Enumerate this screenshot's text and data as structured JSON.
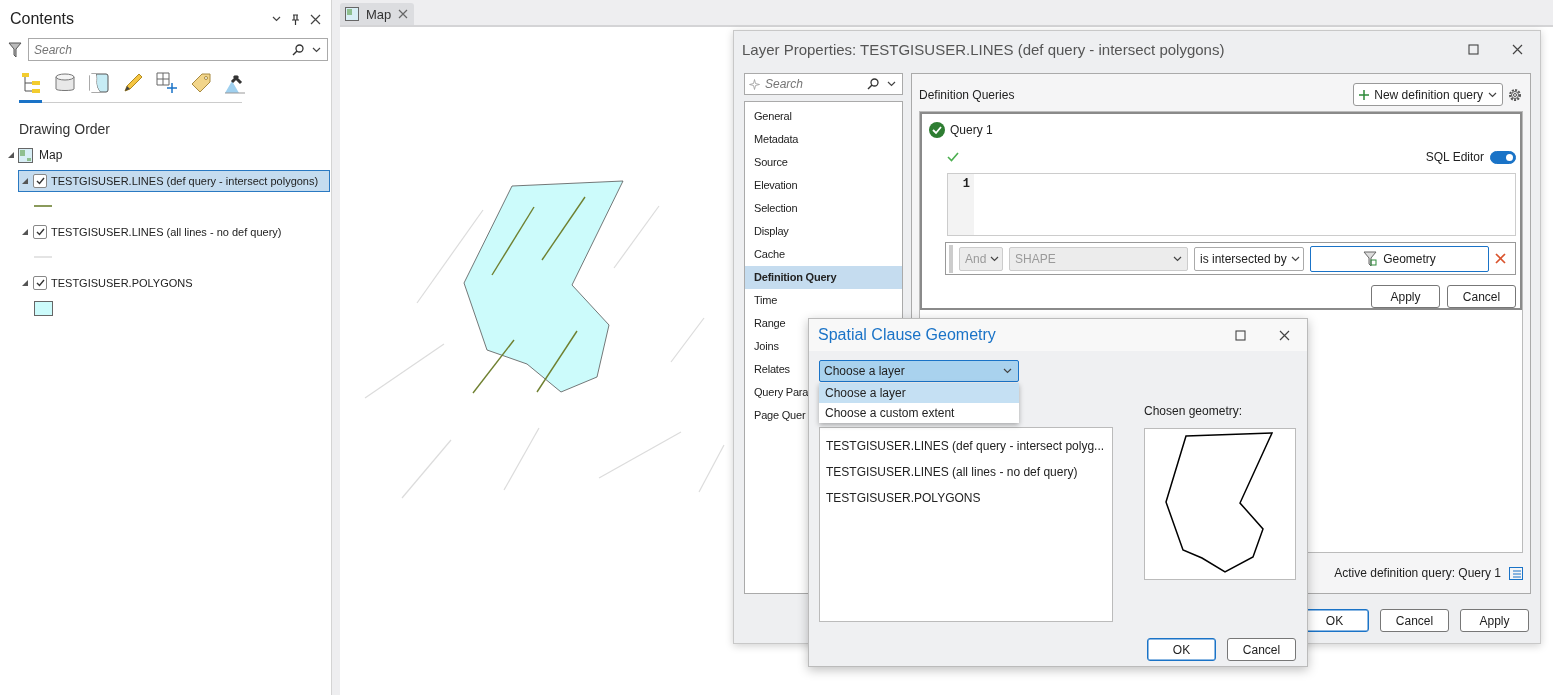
{
  "contents": {
    "title": "Contents",
    "search": {
      "placeholder": "Search"
    },
    "view_tabs": [
      {
        "kind": "tree",
        "selected": true
      },
      {
        "kind": "database",
        "selected": false
      },
      {
        "kind": "map",
        "selected": false
      },
      {
        "kind": "pencil",
        "selected": false
      },
      {
        "kind": "grid",
        "selected": false
      },
      {
        "kind": "tag",
        "selected": false
      },
      {
        "kind": "satellite",
        "selected": false
      }
    ],
    "heading": "Drawing Order",
    "tree": [
      {
        "label": "Map",
        "kind": "map",
        "expanded": true,
        "children": [
          {
            "label": "TESTGISUSER.LINES (def query - intersect polygons)",
            "expanded": true,
            "checked": true,
            "selected": true,
            "symbol": {
              "kind": "line",
              "color": "#8a9a5b"
            }
          },
          {
            "label": "TESTGISUSER.LINES (all lines - no def query)",
            "expanded": true,
            "checked": true,
            "selected": false,
            "symbol": {
              "kind": "line",
              "color": "#e4e4e4"
            }
          },
          {
            "label": "TESTGISUSER.POLYGONS",
            "expanded": true,
            "checked": true,
            "selected": false,
            "symbol": {
              "kind": "fill",
              "color": "#ccfbfb"
            }
          }
        ]
      }
    ]
  },
  "map_tab": {
    "label": "Map",
    "selected": true
  },
  "layer_properties": {
    "title": "Layer Properties: TESTGISUSER.LINES (def query - intersect polygons)",
    "search": {
      "placeholder": "Search"
    },
    "pages": [
      {
        "label": "General",
        "selected": false
      },
      {
        "label": "Metadata",
        "selected": false
      },
      {
        "label": "Source",
        "selected": false
      },
      {
        "label": "Elevation",
        "selected": false
      },
      {
        "label": "Selection",
        "selected": false
      },
      {
        "label": "Display",
        "selected": false
      },
      {
        "label": "Cache",
        "selected": false
      },
      {
        "label": "Definition Query",
        "selected": true
      },
      {
        "label": "Time",
        "selected": false
      },
      {
        "label": "Range",
        "selected": false
      },
      {
        "label": "Joins",
        "selected": false
      },
      {
        "label": "Relates",
        "selected": false
      },
      {
        "label": "Query Para",
        "selected": false
      },
      {
        "label": "Page Quer",
        "selected": false
      }
    ],
    "heading": "Definition Queries",
    "new_button": "New definition query",
    "query": {
      "name": "Query 1",
      "valid": true,
      "sql_editor": {
        "label": "SQL Editor",
        "on": true
      },
      "line_numbers": [
        "1"
      ],
      "clause": {
        "connector": {
          "value": "And",
          "disabled": true
        },
        "field": {
          "value": "SHAPE",
          "disabled": true
        },
        "operator": {
          "value": "is intersected by",
          "disabled": false
        },
        "geometry_button": "Geometry"
      },
      "buttons": [
        {
          "label": "Apply",
          "default": false
        },
        {
          "label": "Cancel",
          "default": false
        }
      ]
    },
    "active_query": "Active definition query: Query 1",
    "buttons": [
      {
        "label": "OK",
        "default": true
      },
      {
        "label": "Cancel",
        "default": false
      },
      {
        "label": "Apply",
        "default": false
      }
    ]
  },
  "spatial_dialog": {
    "title": "Spatial Clause Geometry",
    "dropdown": {
      "value": "Choose a layer",
      "expanded": true,
      "options": [
        {
          "label": "Choose a layer",
          "selected": true
        },
        {
          "label": "Choose a custom extent",
          "selected": false
        }
      ]
    },
    "layers": [
      {
        "label": "TESTGISUSER.LINES (def query - intersect polyg...",
        "selected": false
      },
      {
        "label": "TESTGISUSER.LINES (all lines - no def query)",
        "selected": false
      },
      {
        "label": "TESTGISUSER.POLYGONS",
        "selected": false
      }
    ],
    "chosen_label": "Chosen geometry:",
    "buttons": [
      {
        "label": "OK",
        "default": true
      },
      {
        "label": "Cancel",
        "default": false
      }
    ]
  }
}
